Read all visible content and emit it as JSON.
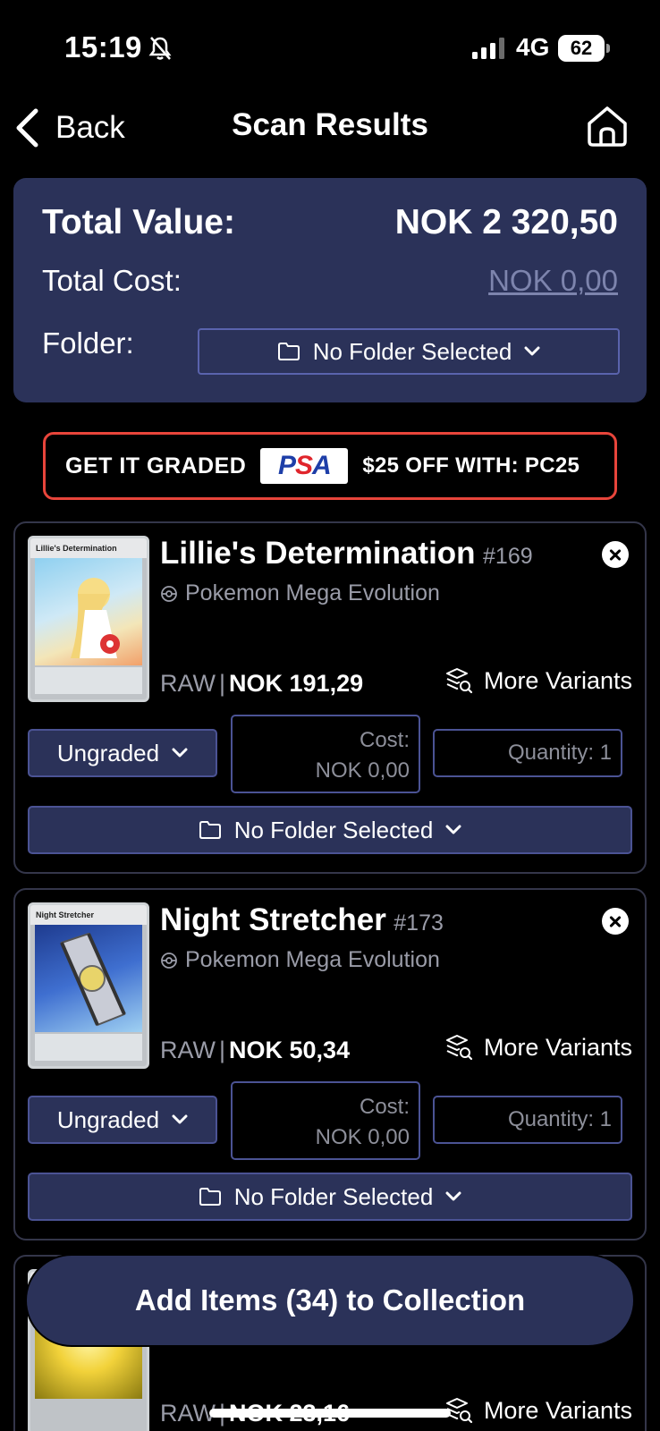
{
  "status_bar": {
    "time": "15:19",
    "network": "4G",
    "battery": "62"
  },
  "nav": {
    "back_label": "Back",
    "title": "Scan Results"
  },
  "summary": {
    "total_value_label": "Total Value:",
    "total_value": "NOK 2 320,50",
    "total_cost_label": "Total Cost:",
    "total_cost": "NOK 0,00",
    "folder_label": "Folder:",
    "folder_value": "No Folder Selected"
  },
  "promo": {
    "left_text": "GET IT GRADED",
    "logo_text": "PSA",
    "offer_text": "$25 OFF WITH:",
    "code": "PC25"
  },
  "cards": [
    {
      "name": "Lillie's Determination",
      "number": "#169",
      "set": "Pokemon Mega Evolution",
      "image_title": "Lillie's Determination",
      "condition": "RAW",
      "price": "NOK 191,29",
      "variants_label": "More Variants",
      "grade": "Ungraded",
      "cost_label": "Cost:",
      "cost_value": "NOK 0,00",
      "quantity": "Quantity: 1",
      "folder": "No Folder Selected"
    },
    {
      "name": "Night Stretcher",
      "number": "#173",
      "set": "Pokemon Mega Evolution",
      "image_title": "Night Stretcher",
      "condition": "RAW",
      "price": "NOK 50,34",
      "variants_label": "More Variants",
      "grade": "Ungraded",
      "cost_label": "Cost:",
      "cost_value": "NOK 0,00",
      "quantity": "Quantity: 1",
      "folder": "No Folder Selected"
    },
    {
      "condition": "RAW",
      "price": "NOK 23,16",
      "variants_label": "More Variants"
    }
  ],
  "add_button_label": "Add Items (34) to Collection",
  "colors": {
    "panel": "#2b3259",
    "border": "#4b5394",
    "promo_border": "#e8453b",
    "muted": "#9a9ca8"
  },
  "icons": [
    "bell-slash-icon",
    "signal-icon",
    "chevron-left-icon",
    "home-icon",
    "folder-icon",
    "chevron-down-icon",
    "close-icon",
    "pokeball-icon",
    "variants-search-icon"
  ]
}
